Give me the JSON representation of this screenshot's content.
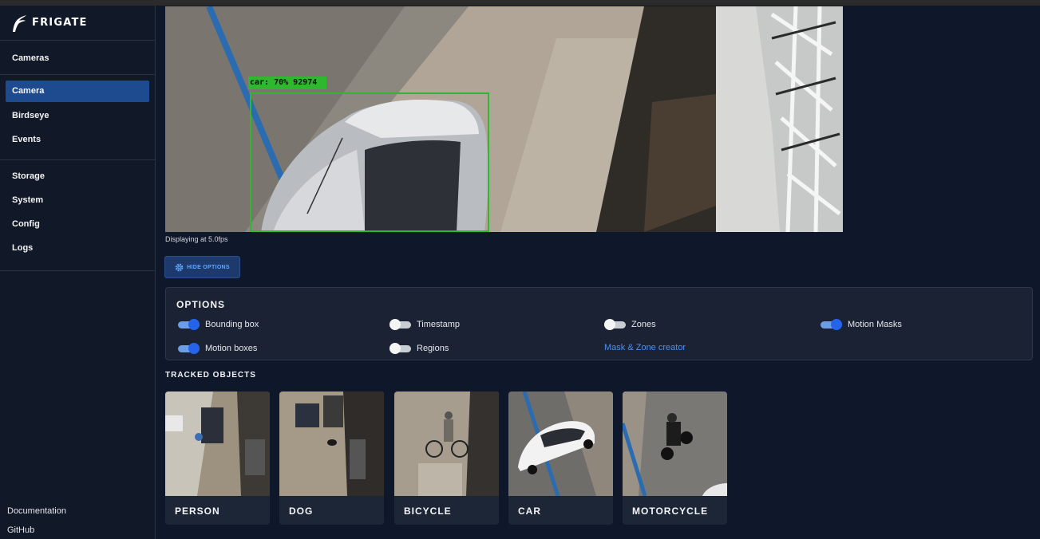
{
  "app": {
    "name": "FRIGATE"
  },
  "sidebar": {
    "group1": [
      {
        "label": "Cameras"
      }
    ],
    "group2": [
      {
        "label": "Camera",
        "active": true
      },
      {
        "label": "Birdseye"
      },
      {
        "label": "Events"
      }
    ],
    "group3": [
      {
        "label": "Storage"
      },
      {
        "label": "System"
      },
      {
        "label": "Config"
      },
      {
        "label": "Logs"
      }
    ],
    "bottom": [
      {
        "label": "Documentation"
      },
      {
        "label": "GitHub"
      }
    ]
  },
  "video": {
    "detection_label": "car: 70% 92974",
    "status_text": "Displaying at 5.0fps"
  },
  "hide_options_button": {
    "label": "HIDE OPTIONS",
    "icon": "gear-icon"
  },
  "options": {
    "title": "OPTIONS",
    "items": [
      {
        "label": "Bounding box",
        "enabled": true
      },
      {
        "label": "Timestamp",
        "enabled": false
      },
      {
        "label": "Zones",
        "enabled": false
      },
      {
        "label": "Motion Masks",
        "enabled": true
      },
      {
        "label": "Motion boxes",
        "enabled": true
      },
      {
        "label": "Regions",
        "enabled": false
      }
    ],
    "link_label": "Mask & Zone creator"
  },
  "tracked": {
    "title": "TRACKED OBJECTS",
    "objects": [
      {
        "label": "PERSON"
      },
      {
        "label": "DOG"
      },
      {
        "label": "BICYCLE"
      },
      {
        "label": "CAR"
      },
      {
        "label": "MOTORCYCLE"
      }
    ]
  },
  "colors": {
    "background": "#0f172a",
    "sidebar": "#111827",
    "accent": "#1e4b8f",
    "link": "#4f8ff0",
    "toggle_on": "#2563eb",
    "detection_box": "#2db82d"
  }
}
